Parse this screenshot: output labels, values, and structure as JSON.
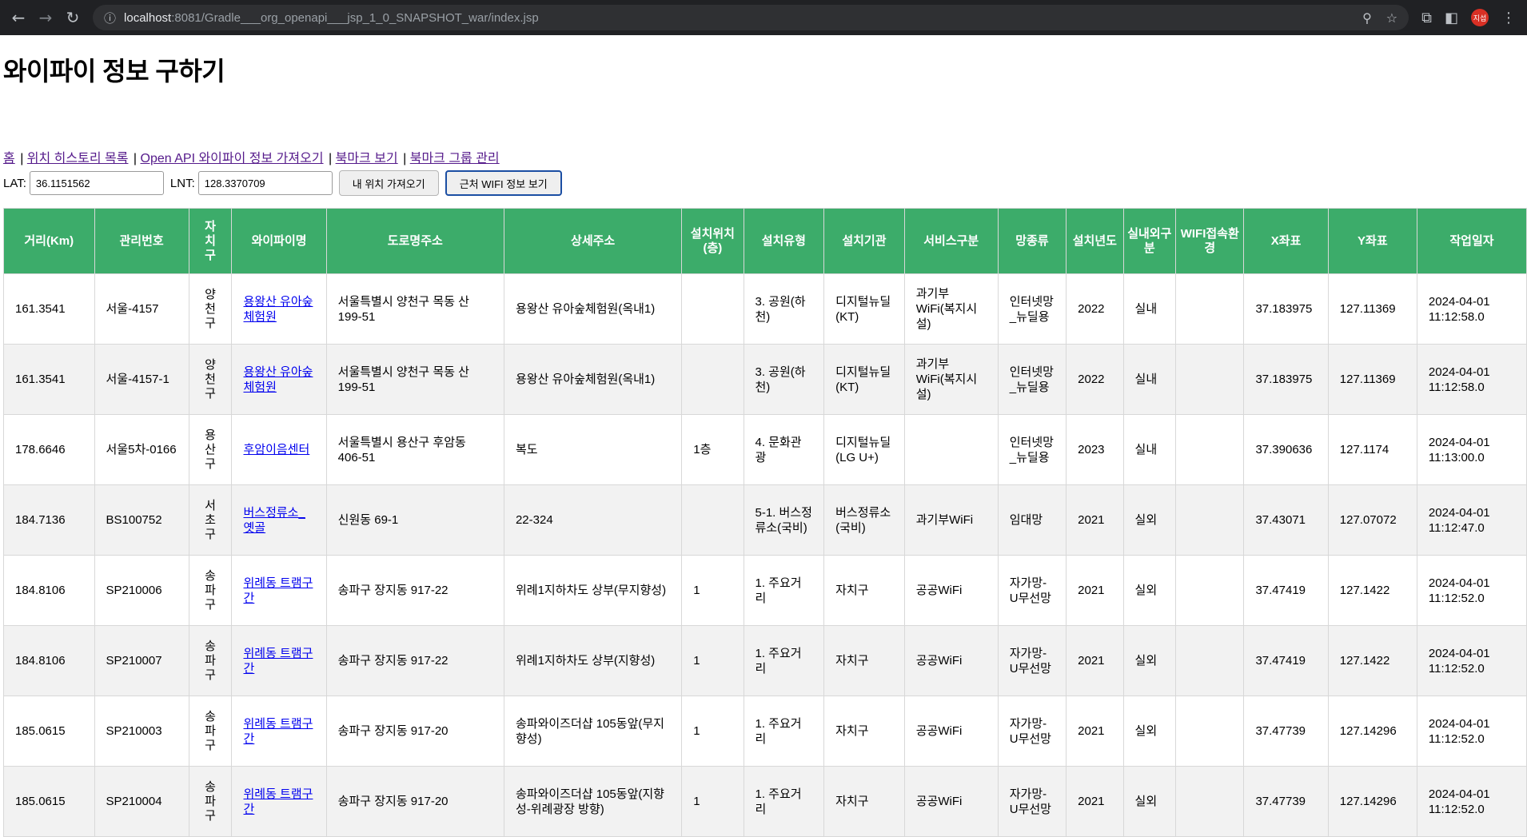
{
  "browser": {
    "url_host": "localhost",
    "url_rest": ":8081/Gradle___org_openapi___jsp_1_0_SNAPSHOT_war/index.jsp",
    "profile_label": "지섭"
  },
  "page": {
    "title": "와이파이 정보 구하기",
    "menu": [
      "홈",
      "위치 히스토리 목록",
      "Open API 와이파이 정보 가져오기",
      "북마크 보기",
      "북마크 그룹 관리"
    ],
    "lat_label": "LAT:",
    "lat_value": "36.1151562",
    "lnt_label": "LNT:",
    "lnt_value": "128.3370709",
    "my_location_button": "내 위치 가져오기",
    "nearby_wifi_button": "근처 WIFI 정보 보기"
  },
  "table": {
    "headers": [
      "거리(Km)",
      "관리번호",
      "자치구",
      "와이파이명",
      "도로명주소",
      "상세주소",
      "설치위치(층)",
      "설치유형",
      "설치기관",
      "서비스구분",
      "망종류",
      "설치년도",
      "실내외구분",
      "WIFI접속환경",
      "X좌표",
      "Y좌표",
      "작업일자"
    ],
    "rows": [
      [
        "161.3541",
        "서울-4157",
        "양천구",
        "용왕산 유아숲체험원",
        "서울특별시 양천구 목동 산199-51",
        "용왕산 유아숲체험원(옥내1)",
        "",
        "3. 공원(하천)",
        "디지털뉴딜(KT)",
        "과기부WiFi(복지시설)",
        "인터넷망_뉴딜용",
        "2022",
        "실내",
        "",
        "37.183975",
        "127.11369",
        "2024-04-01 11:12:58.0"
      ],
      [
        "161.3541",
        "서울-4157-1",
        "양천구",
        "용왕산 유아숲체험원",
        "서울특별시 양천구 목동 산199-51",
        "용왕산 유아숲체험원(옥내1)",
        "",
        "3. 공원(하천)",
        "디지털뉴딜(KT)",
        "과기부WiFi(복지시설)",
        "인터넷망_뉴딜용",
        "2022",
        "실내",
        "",
        "37.183975",
        "127.11369",
        "2024-04-01 11:12:58.0"
      ],
      [
        "178.6646",
        "서울5차-0166",
        "용산구",
        "후암이음센터",
        "서울특별시 용산구 후암동 406-51",
        "복도",
        "1층",
        "4. 문화관광",
        "디지털뉴딜(LG U+)",
        "",
        "인터넷망_뉴딜용",
        "2023",
        "실내",
        "",
        "37.390636",
        "127.1174",
        "2024-04-01 11:13:00.0"
      ],
      [
        "184.7136",
        "BS100752",
        "서초구",
        "버스정류소_옛골",
        "신원동 69-1",
        "22-324",
        "",
        "5-1. 버스정류소(국비)",
        "버스정류소(국비)",
        "과기부WiFi",
        "임대망",
        "2021",
        "실외",
        "",
        "37.43071",
        "127.07072",
        "2024-04-01 11:12:47.0"
      ],
      [
        "184.8106",
        "SP210006",
        "송파구",
        "위례동 트램구간",
        "송파구 장지동 917-22",
        "위례1지하차도 상부(무지향성)",
        "1",
        "1. 주요거리",
        "자치구",
        "공공WiFi",
        "자가망-U무선망",
        "2021",
        "실외",
        "",
        "37.47419",
        "127.1422",
        "2024-04-01 11:12:52.0"
      ],
      [
        "184.8106",
        "SP210007",
        "송파구",
        "위례동 트램구간",
        "송파구 장지동 917-22",
        "위례1지하차도 상부(지향성)",
        "1",
        "1. 주요거리",
        "자치구",
        "공공WiFi",
        "자가망-U무선망",
        "2021",
        "실외",
        "",
        "37.47419",
        "127.1422",
        "2024-04-01 11:12:52.0"
      ],
      [
        "185.0615",
        "SP210003",
        "송파구",
        "위례동 트램구간",
        "송파구 장지동 917-20",
        "송파와이즈더샵 105동앞(무지향성)",
        "1",
        "1. 주요거리",
        "자치구",
        "공공WiFi",
        "자가망-U무선망",
        "2021",
        "실외",
        "",
        "37.47739",
        "127.14296",
        "2024-04-01 11:12:52.0"
      ],
      [
        "185.0615",
        "SP210004",
        "송파구",
        "위례동 트램구간",
        "송파구 장지동 917-20",
        "송파와이즈더샵 105동앞(지향성-위례광장 방향)",
        "1",
        "1. 주요거리",
        "자치구",
        "공공WiFi",
        "자가망-U무선망",
        "2021",
        "실외",
        "",
        "37.47739",
        "127.14296",
        "2024-04-01 11:12:52.0"
      ]
    ]
  }
}
